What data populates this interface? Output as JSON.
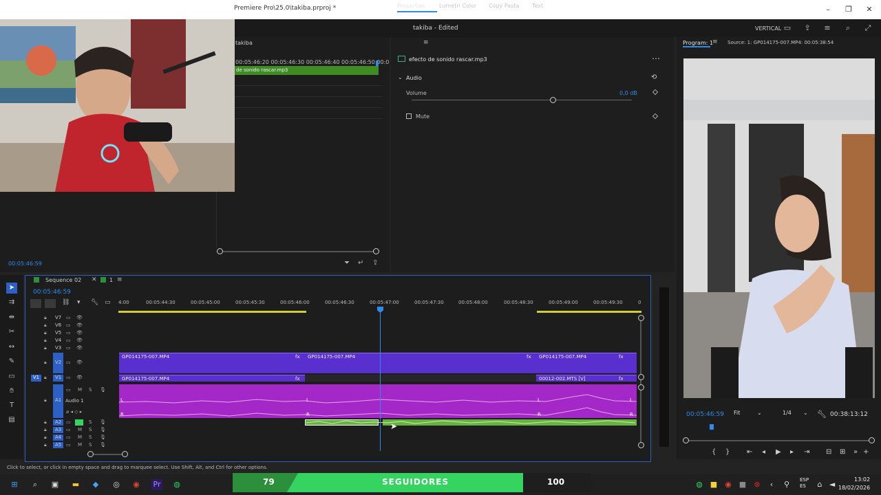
{
  "window": {
    "title": "Premiere Pro\\25.0\\takiba.prproj *",
    "project_title": "takiba - Edited",
    "workspace_label": "VERTICAL"
  },
  "source_panel": {
    "tab": "takiba",
    "ruler_text": "00:05:46:20   00:05:46:30   00:05:46:40   00:05:46:50   00:0",
    "clip_name": "de sonido rascar.mp3",
    "timecode": "00:05:46:59"
  },
  "properties": {
    "tabs": [
      "Properties",
      "Lumetri Color",
      "Copy Pasta",
      "Text"
    ],
    "clip_name": "efecto de sonido rascar.mp3",
    "section": "Audio",
    "volume_label": "Volume",
    "volume_value": "0,0 dB",
    "volume_level_pct": 64,
    "mute_label": "Mute"
  },
  "program": {
    "tab": "Program: 1",
    "source_label": "Source: 1: GP014175-007.MP4: 00:05:38:54",
    "timecode": "00:05:46:59",
    "fit": "Fit",
    "resolution": "1/4",
    "duration": "00:38:13:12"
  },
  "timeline": {
    "sequence": "Sequence 02",
    "sequence2": "1",
    "timecode": "00:05:46:59",
    "ruler": [
      "4:00",
      "00:05:44:30",
      "00:05:45:00",
      "00:05:45:30",
      "00:05:46:00",
      "00:05:46:30",
      "00:05:47:00",
      "00:05:47:30",
      "00:05:48:00",
      "00:05:48:30",
      "00:05:49:00",
      "00:05:49:30",
      "0"
    ],
    "video_tracks": [
      "V7",
      "V6",
      "V5",
      "V4",
      "V3",
      "V2",
      "V1"
    ],
    "audio_tracks": [
      "A1",
      "A2",
      "A3",
      "A4",
      "A5"
    ],
    "audio_track_name": "Audio 1",
    "v2_clips": [
      "GP014175-007.MP4",
      "GP014175-007.MP4",
      "GP014175-007.MP4"
    ],
    "v1_clips": [
      "GP014175-007.MP4",
      "00012-002.MTS [V]"
    ],
    "fx": "fx",
    "channel_l": "L",
    "channel_r": "R",
    "track_letters": {
      "m": "M",
      "s": "S",
      "v1_label": "V1"
    }
  },
  "status_bar": "Click to select, or click in empty space and drag to marquee select. Use Shift, Alt, and Ctrl for other options.",
  "overlay": {
    "left": "79",
    "center": "SEGUIDORES",
    "right": "100"
  },
  "taskbar": {
    "lang": "ESP",
    "lang2": "ES",
    "time": "13:02",
    "date": "18/02/2026"
  },
  "colors": {
    "accent": "#2d8ceb",
    "video_clip": "#5a2fcf",
    "audio_clip": "#a427c8",
    "a2_clip": "#68b241",
    "overlay_green": "#35d35f"
  }
}
